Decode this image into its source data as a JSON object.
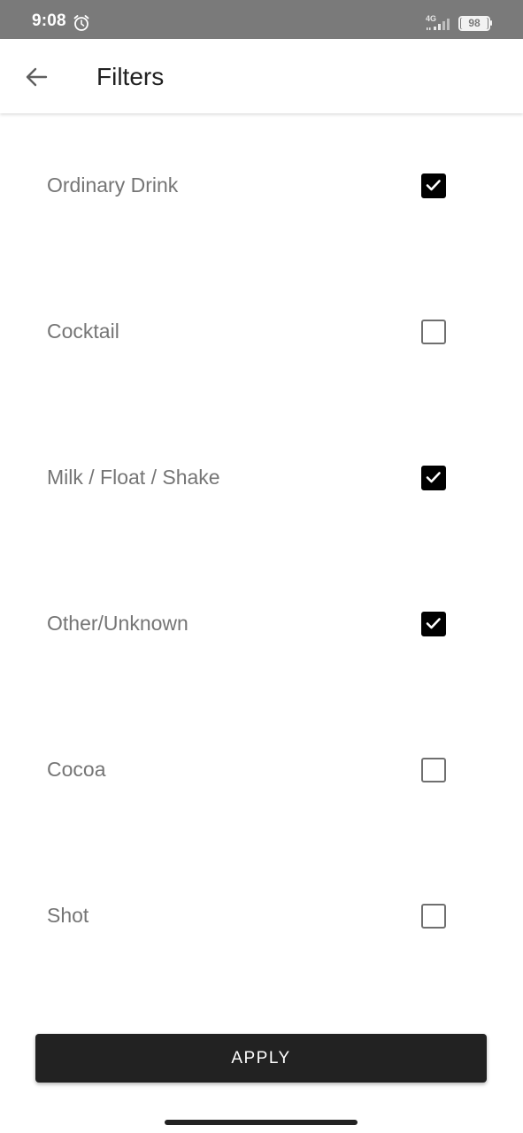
{
  "status_bar": {
    "time": "9:08",
    "network": "4G",
    "battery": "98",
    "icons": [
      "alarm-icon",
      "signal-icon",
      "battery-icon"
    ]
  },
  "app_bar": {
    "title": "Filters",
    "back_icon": "arrow-left-icon"
  },
  "filters": [
    {
      "label": "Ordinary Drink",
      "checked": true
    },
    {
      "label": "Cocktail",
      "checked": false
    },
    {
      "label": "Milk / Float / Shake",
      "checked": true
    },
    {
      "label": "Other/Unknown",
      "checked": true
    },
    {
      "label": "Cocoa",
      "checked": false
    },
    {
      "label": "Shot",
      "checked": false
    }
  ],
  "apply_button": {
    "label": "APPLY"
  },
  "colors": {
    "status_bar": "#7a7a7a",
    "button_bg": "#222222",
    "label_text": "#757575",
    "title_text": "#212121"
  }
}
